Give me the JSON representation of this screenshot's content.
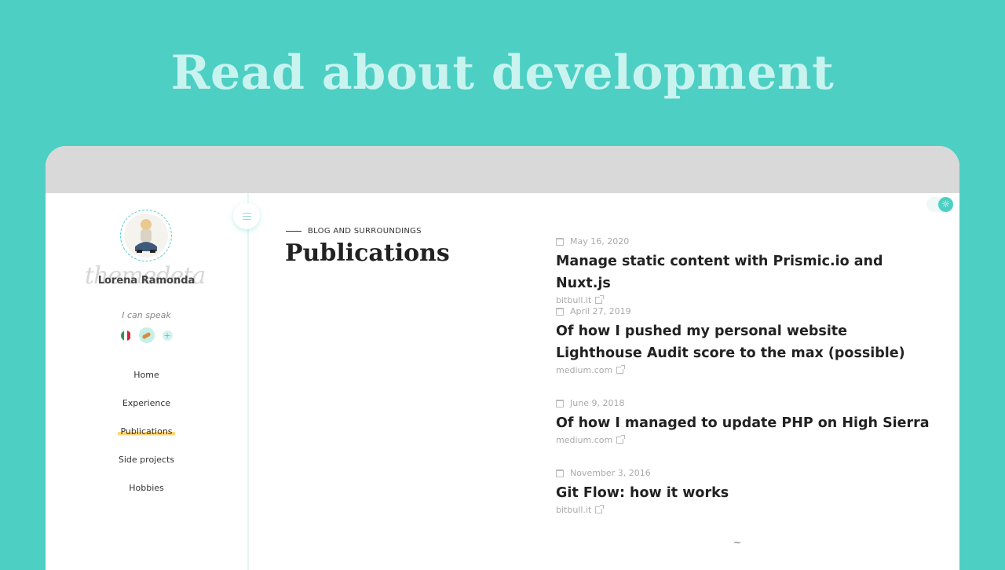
{
  "hero": {
    "title": "Read about development"
  },
  "sidebar": {
    "author_name": "Lorena Ramonda",
    "speak_label": "I can speak",
    "nav": [
      {
        "label": "Home",
        "active": false
      },
      {
        "label": "Experience",
        "active": false
      },
      {
        "label": "Publications",
        "active": true
      },
      {
        "label": "Side projects",
        "active": false
      },
      {
        "label": "Hobbies",
        "active": false
      }
    ],
    "languages": [
      "italian-flag-icon",
      "food-icon",
      "plus-icon"
    ]
  },
  "section": {
    "eyebrow": "BLOG AND SURROUNDINGS",
    "title": "Publications"
  },
  "publications": [
    {
      "date": "May 16, 2020",
      "title": "Manage static content with Prismic.io and Nuxt.js",
      "source": "bitbull.it"
    },
    {
      "date": "April 27, 2019",
      "title": "Of how I pushed my personal website Lighthouse Audit score to the max (possible)",
      "source": "medium.com"
    },
    {
      "date": "June 9, 2018",
      "title": "Of how I managed to update PHP on High Sierra",
      "source": "medium.com"
    },
    {
      "date": "November 3, 2016",
      "title": "Git Flow: how it works",
      "source": "bitbull.it"
    }
  ],
  "footer": {
    "tilde": "~"
  },
  "colors": {
    "background": "#4ecfc4",
    "hero_text": "#c9f3ef",
    "accent": "#4ecfc4",
    "highlight": "#ffd77a"
  }
}
